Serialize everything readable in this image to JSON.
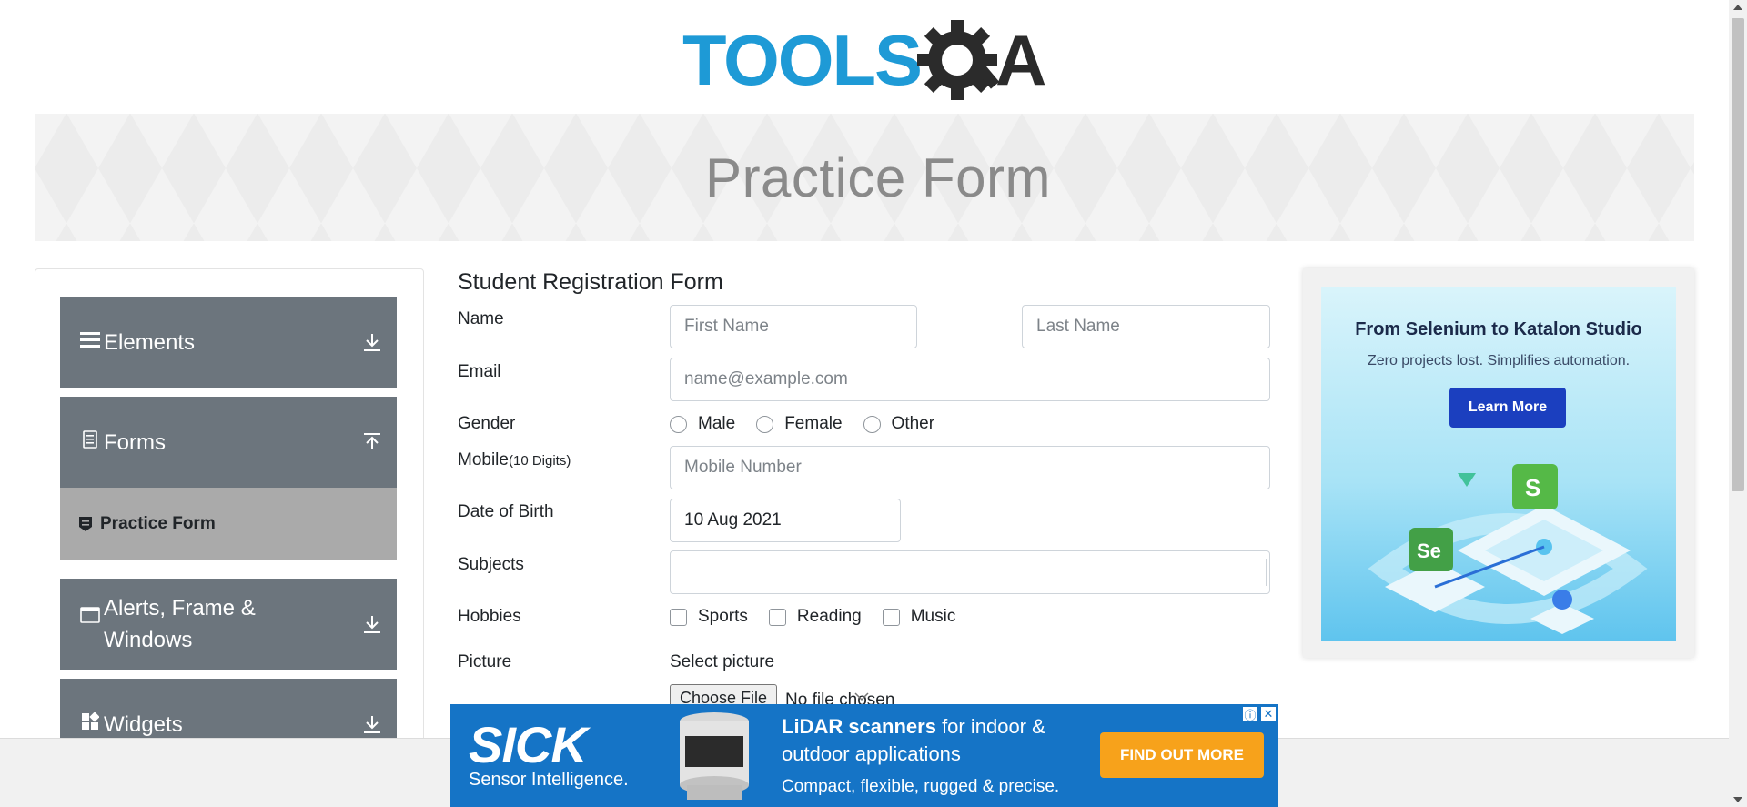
{
  "logo": {
    "text_left": "TOOLS",
    "text_right": "A"
  },
  "banner": {
    "title": "Practice Form"
  },
  "sidebar": {
    "groups": [
      {
        "label": "Elements",
        "icon": "menu-icon",
        "arrow": "download-arrow-icon"
      },
      {
        "label": "Forms",
        "icon": "document-icon",
        "arrow": "upload-arrow-icon"
      },
      {
        "label": "Alerts, Frame & Windows",
        "icon": "window-icon",
        "arrow": "download-arrow-icon"
      },
      {
        "label": "Widgets",
        "icon": "widgets-icon",
        "arrow": "download-arrow-icon"
      }
    ],
    "active_item": {
      "label": "Practice Form",
      "icon": "form-icon"
    }
  },
  "form": {
    "title": "Student Registration Form",
    "name_label": "Name",
    "first_name_placeholder": "First Name",
    "last_name_placeholder": "Last Name",
    "email_label": "Email",
    "email_placeholder": "name@example.com",
    "gender_label": "Gender",
    "gender_options": [
      "Male",
      "Female",
      "Other"
    ],
    "mobile_label": "Mobile",
    "mobile_hint": "(10 Digits)",
    "mobile_placeholder": "Mobile Number",
    "dob_label": "Date of Birth",
    "dob_value": "10 Aug 2021",
    "subjects_label": "Subjects",
    "hobbies_label": "Hobbies",
    "hobby_options": [
      "Sports",
      "Reading",
      "Music"
    ],
    "picture_label": "Picture",
    "select_picture_label": "Select picture",
    "choose_file_label": "Choose File",
    "file_status": "No file chosen"
  },
  "right_ad": {
    "title": "From Selenium to Katalon Studio",
    "subtitle": "Zero projects lost. Simplifies automation.",
    "button": "Learn More",
    "badge_s": "S",
    "badge_se": "Se"
  },
  "bottom_ad": {
    "brand": "SICK",
    "tagline": "Sensor Intelligence.",
    "line1_bold": "LiDAR scanners",
    "line1_rest": " for indoor &",
    "line2": "outdoor applications",
    "line3": "Compact, flexible, rugged & precise.",
    "button": "FIND OUT MORE",
    "info_glyph": "ⓘ",
    "close_glyph": "✕"
  },
  "colors": {
    "logo_blue": "#1e9ad6",
    "logo_dark": "#2b2b2b",
    "sidebar_group": "#6c757d",
    "sidebar_active": "#aaaaaa",
    "ad_button": "#1b3fbf",
    "bottom_ad_bg": "#1574c6",
    "bottom_ad_button": "#f7a21b"
  }
}
